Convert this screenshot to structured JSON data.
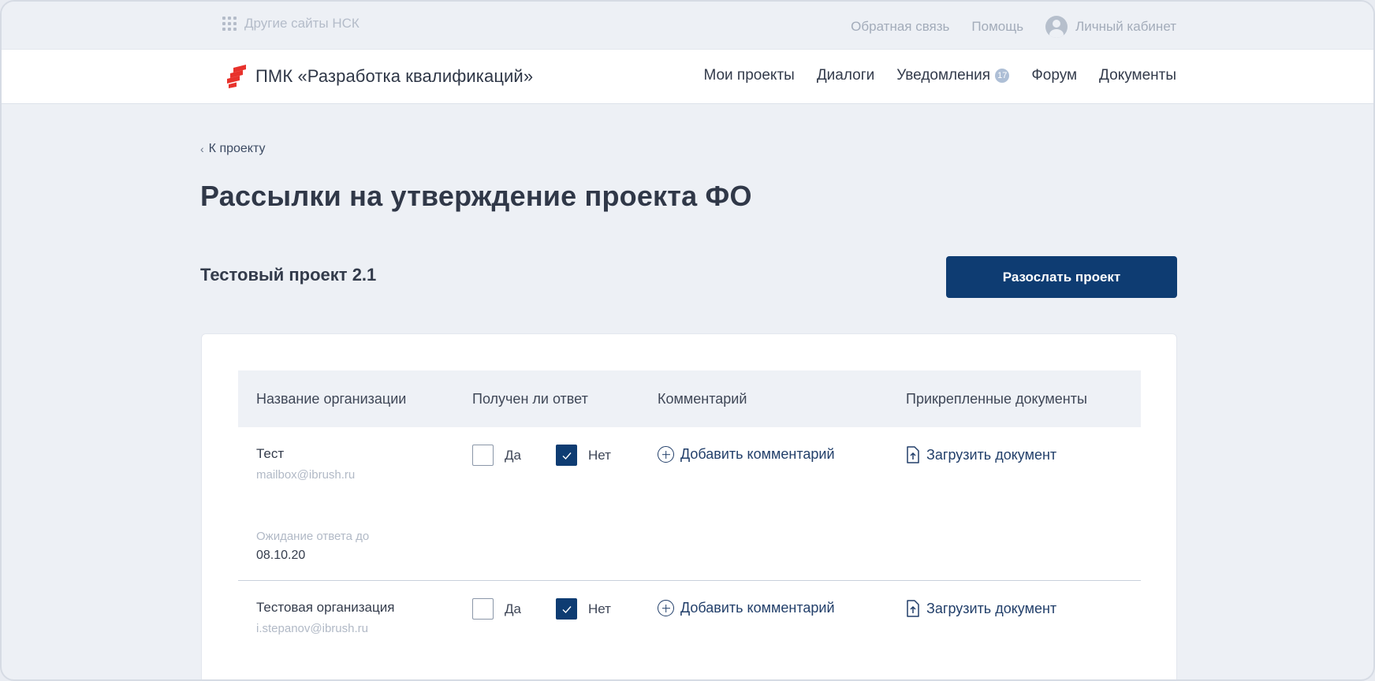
{
  "topbar": {
    "other_sites": "Другие сайты НСК",
    "feedback": "Обратная связь",
    "help": "Помощь",
    "cabinet": "Личный кабинет"
  },
  "brand": {
    "title": "ПМК «Разработка квалификаций»",
    "logo_color": "#e8322c"
  },
  "nav": {
    "my_projects": "Мои проекты",
    "dialogs": "Диалоги",
    "notifications": "Уведомления",
    "notifications_count": "17",
    "forum": "Форум",
    "documents": "Документы"
  },
  "back_link": "К проекту",
  "page_title": "Рассылки на утверждение проекта ФО",
  "project_name": "Тестовый проект 2.1",
  "send_button": "Разослать проект",
  "accent_color": "#0e3c72",
  "table": {
    "headers": {
      "org": "Название организации",
      "answered": "Получен ли ответ",
      "comment": "Комментарий",
      "docs": "Прикрепленные документы"
    },
    "yes_label": "Да",
    "no_label": "Нет",
    "add_comment": "Добавить комментарий",
    "upload_doc": "Загрузить документ",
    "wait_label": "Ожидание ответа до",
    "rows": [
      {
        "org": "Тест",
        "email": "mailbox@ibrush.ru",
        "yes_checked": false,
        "no_checked": true,
        "wait_date": "08.10.20"
      },
      {
        "org": "Тестовая организация",
        "email": "i.stepanov@ibrush.ru",
        "yes_checked": false,
        "no_checked": true
      }
    ]
  }
}
